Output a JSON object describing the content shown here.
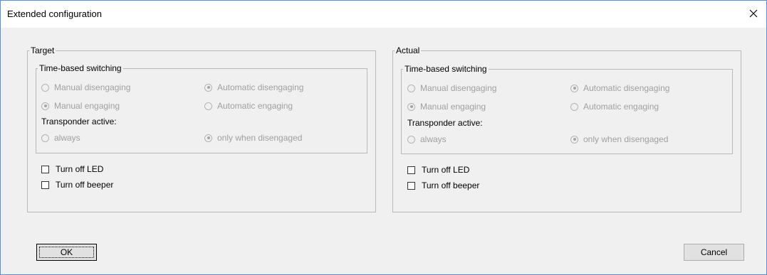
{
  "window": {
    "title": "Extended configuration"
  },
  "target": {
    "legend": "Target",
    "time_based": {
      "legend": "Time-based switching",
      "manual_disengaging": "Manual disengaging",
      "automatic_disengaging": "Automatic disengaging",
      "manual_engaging": "Manual engaging",
      "automatic_engaging": "Automatic engaging",
      "transponder_label": "Transponder active:",
      "always": "always",
      "only_disengaged": "only when disengaged"
    },
    "turn_off_led": "Turn off LED",
    "turn_off_beeper": "Turn off beeper"
  },
  "actual": {
    "legend": "Actual",
    "time_based": {
      "legend": "Time-based switching",
      "manual_disengaging": "Manual disengaging",
      "automatic_disengaging": "Automatic disengaging",
      "manual_engaging": "Manual engaging",
      "automatic_engaging": "Automatic engaging",
      "transponder_label": "Transponder active:",
      "always": "always",
      "only_disengaged": "only when disengaged"
    },
    "turn_off_led": "Turn off LED",
    "turn_off_beeper": "Turn off beeper"
  },
  "buttons": {
    "ok": "OK",
    "cancel": "Cancel"
  },
  "icons": {
    "close": "close-icon"
  },
  "colors": {
    "window_border": "#5b8fd0",
    "dialog_bg": "#f0f0f0",
    "disabled_text": "#a0a0a0"
  }
}
